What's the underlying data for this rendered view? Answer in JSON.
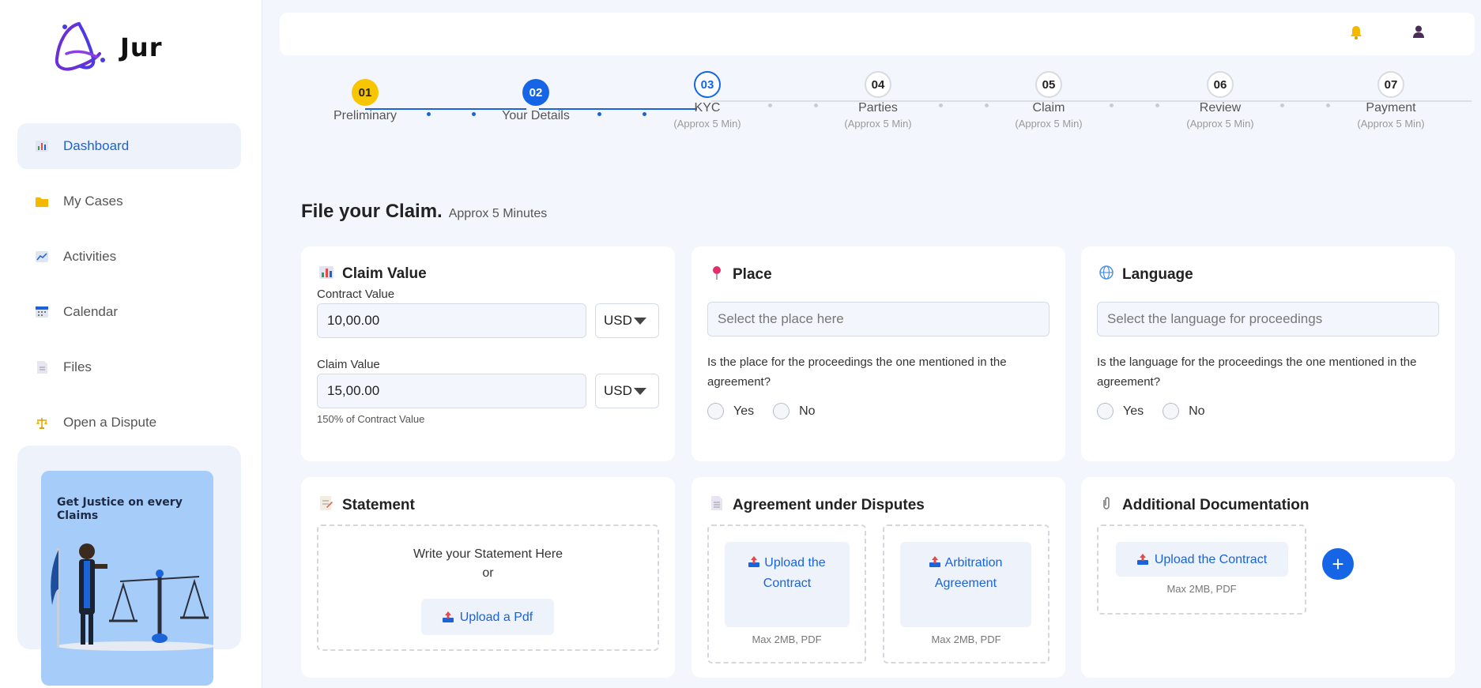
{
  "app": {
    "name": "Jur"
  },
  "sidebar": {
    "items": [
      {
        "label": "Dashboard",
        "icon": "bar-chart-icon"
      },
      {
        "label": "My Cases",
        "icon": "folder-icon"
      },
      {
        "label": "Activities",
        "icon": "line-chart-icon"
      },
      {
        "label": "Calendar",
        "icon": "calendar-icon"
      },
      {
        "label": "Files",
        "icon": "file-icon"
      },
      {
        "label": "Open a Dispute",
        "icon": "scales-icon"
      }
    ],
    "promo": {
      "text": "Get Justice on every Claims"
    }
  },
  "topbar": {
    "icons": [
      "bell-icon",
      "user-icon"
    ]
  },
  "stepper": {
    "steps": [
      {
        "number": "01",
        "name": "Preliminary",
        "sub": "",
        "status": "complete"
      },
      {
        "number": "02",
        "name": "Your Details",
        "sub": "",
        "status": "complete"
      },
      {
        "number": "03",
        "name": "KYC",
        "sub": "(Approx 5 Min)",
        "status": "current"
      },
      {
        "number": "04",
        "name": "Parties",
        "sub": "(Approx 5 Min)",
        "status": "pending"
      },
      {
        "number": "05",
        "name": "Claim",
        "sub": "(Approx 5 Min)",
        "status": "pending"
      },
      {
        "number": "06",
        "name": "Review",
        "sub": "(Approx 5 Min)",
        "status": "pending"
      },
      {
        "number": "07",
        "name": "Payment",
        "sub": "(Approx 5 Min)",
        "status": "pending"
      }
    ]
  },
  "heading": {
    "title": "File your Claim.",
    "sub": "Approx 5 Minutes"
  },
  "claim_value": {
    "title": "Claim Value",
    "contract_label": "Contract Value",
    "contract_value": "10,00.00",
    "contract_currency": "USD",
    "claim_label": "Claim Value",
    "claim_value": "15,00.00",
    "claim_currency": "USD",
    "hint": "150% of Contract Value"
  },
  "place": {
    "title": "Place",
    "placeholder": "Select the place here",
    "question": "Is the place for the proceedings the one mentioned in the agreement?",
    "yes": "Yes",
    "no": "No"
  },
  "language": {
    "title": "Language",
    "placeholder": "Select the language for proceedings",
    "question": "Is the language for the proceedings the one mentioned in the agreement?",
    "yes": "Yes",
    "no": "No"
  },
  "statement": {
    "title": "Statement",
    "write_text": "Write your Statement Here",
    "or_text": "or",
    "upload_label": "Upload a Pdf"
  },
  "agreement": {
    "title": "Agreement under Disputes",
    "upload_contract": "Upload the Contract",
    "upload_arbitration": "Arbitration Agreement",
    "note_contract": "Max 2MB, PDF",
    "note_arbitration": "Max 2MB, PDF"
  },
  "additional": {
    "title": "Additional Documentation",
    "upload_contract": "Upload the Contract",
    "note": "Max 2MB, PDF",
    "add_label": "+"
  },
  "colors": {
    "accent": "#1565e6",
    "step1": "#f7c600",
    "logo": "#6a2fd6"
  }
}
